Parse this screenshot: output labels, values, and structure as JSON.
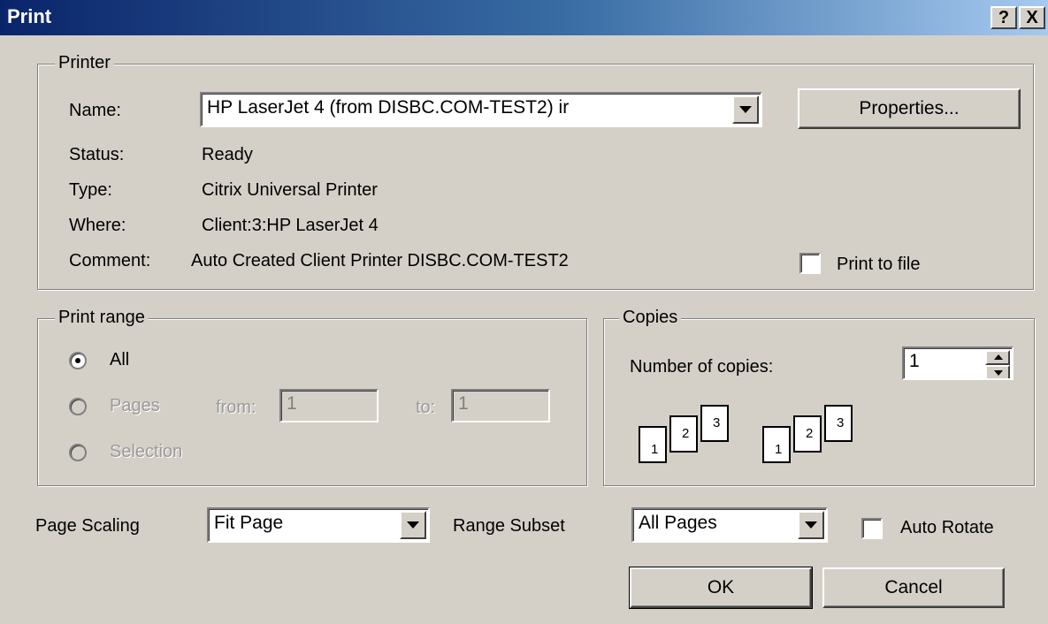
{
  "window": {
    "title": "Print",
    "help_glyph": "?",
    "close_glyph": "X"
  },
  "printer": {
    "legend": "Printer",
    "name_label": "Name:",
    "name_value": "HP LaserJet 4 (from DISBC.COM-TEST2) ir",
    "properties_label": "Properties...",
    "status_label": "Status:",
    "status_value": "Ready",
    "type_label": "Type:",
    "type_value": "Citrix Universal Printer",
    "where_label": "Where:",
    "where_value": "Client:3:HP LaserJet 4",
    "comment_label": "Comment:",
    "comment_value": "Auto Created Client Printer DISBC.COM-TEST2",
    "print_to_file_label": "Print to file",
    "print_to_file_checked": false
  },
  "print_range": {
    "legend": "Print range",
    "all_label": "All",
    "pages_label": "Pages",
    "from_label": "from:",
    "from_value": "1",
    "to_label": "to:",
    "to_value": "1",
    "selection_label": "Selection",
    "selected": "All"
  },
  "copies": {
    "legend": "Copies",
    "number_label": "Number of copies:",
    "number_value": "1",
    "collate_icon": "collate-pages-icon",
    "page_numbers": [
      "1",
      "2",
      "3"
    ]
  },
  "options": {
    "page_scaling_label": "Page Scaling",
    "page_scaling_value": "Fit Page",
    "range_subset_label": "Range Subset",
    "range_subset_value": "All Pages",
    "auto_rotate_label": "Auto Rotate",
    "auto_rotate_checked": false
  },
  "buttons": {
    "ok_label": "OK",
    "cancel_label": "Cancel"
  },
  "colors": {
    "dialog_bg": "#d4d0c8",
    "title_start": "#0a246a",
    "title_end": "#a6caf0"
  }
}
